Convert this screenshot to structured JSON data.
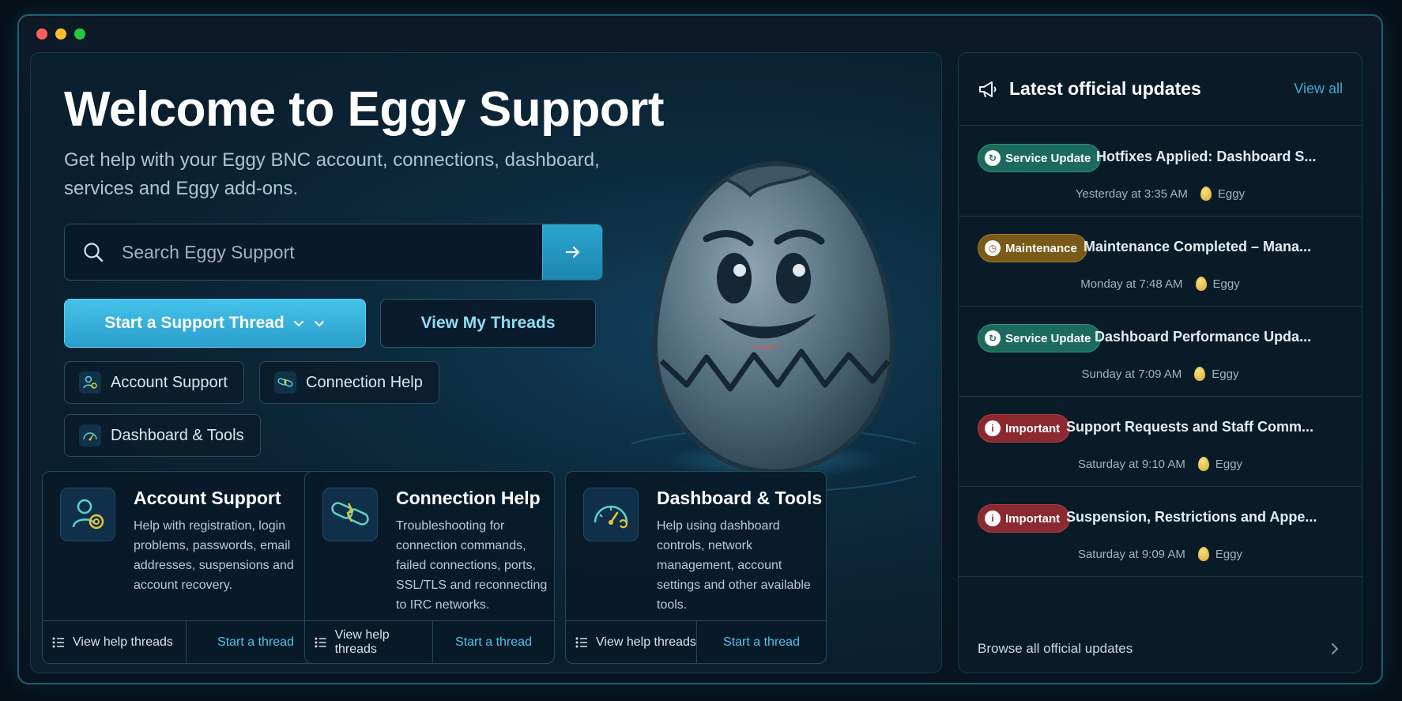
{
  "hero": {
    "title": "Welcome to Eggy Support",
    "subtitle": "Get help with your Eggy BNC account, connections, dashboard, services and Eggy add-ons."
  },
  "search": {
    "placeholder": "Search Eggy Support"
  },
  "actions": {
    "start_thread": "Start a Support Thread",
    "view_threads": "View My Threads"
  },
  "chips": [
    {
      "label": "Account Support"
    },
    {
      "label": "Connection Help"
    },
    {
      "label": "Dashboard & Tools"
    }
  ],
  "cards": [
    {
      "title": "Account Support",
      "description": "Help with registration, login problems, passwords, email addresses, suspensions and account recovery.",
      "view_label": "View help threads",
      "start_label": "Start a thread"
    },
    {
      "title": "Connection Help",
      "description": "Troubleshooting for connection commands, failed connections, ports, SSL/TLS and reconnecting to IRC networks.",
      "view_label": "View help threads",
      "start_label": "Start a thread"
    },
    {
      "title": "Dashboard & Tools",
      "description": "Help using dashboard controls, network management, account settings and other available tools.",
      "view_label": "View help threads",
      "start_label": "Start a thread"
    }
  ],
  "updates": {
    "title": "Latest official updates",
    "view_all": "View all",
    "items": [
      {
        "badge": "Service Update",
        "title": "Hotfixes Applied: Dashboard S...",
        "time": "Yesterday at 3:35 AM",
        "author": "Eggy"
      },
      {
        "badge": "Maintenance",
        "title": "Maintenance Completed – Mana...",
        "time": "Monday at 7:48 AM",
        "author": "Eggy"
      },
      {
        "badge": "Service Update",
        "title": "Dashboard Performance Upda...",
        "time": "Sunday at 7:09 AM",
        "author": "Eggy"
      },
      {
        "badge": "Important",
        "title": "Support Requests and Staff Comm...",
        "time": "Saturday at 9:10 AM",
        "author": "Eggy"
      },
      {
        "badge": "Important",
        "title": "Suspension, Restrictions and Appe...",
        "time": "Saturday at 9:09 AM",
        "author": "Eggy"
      }
    ],
    "browse_all": "Browse all official updates"
  },
  "colors": {
    "accent": "#2aa6cf",
    "service_badge": "#1c6a5e",
    "maintenance_badge": "#7a5a18",
    "important_badge": "#8a2a30"
  }
}
